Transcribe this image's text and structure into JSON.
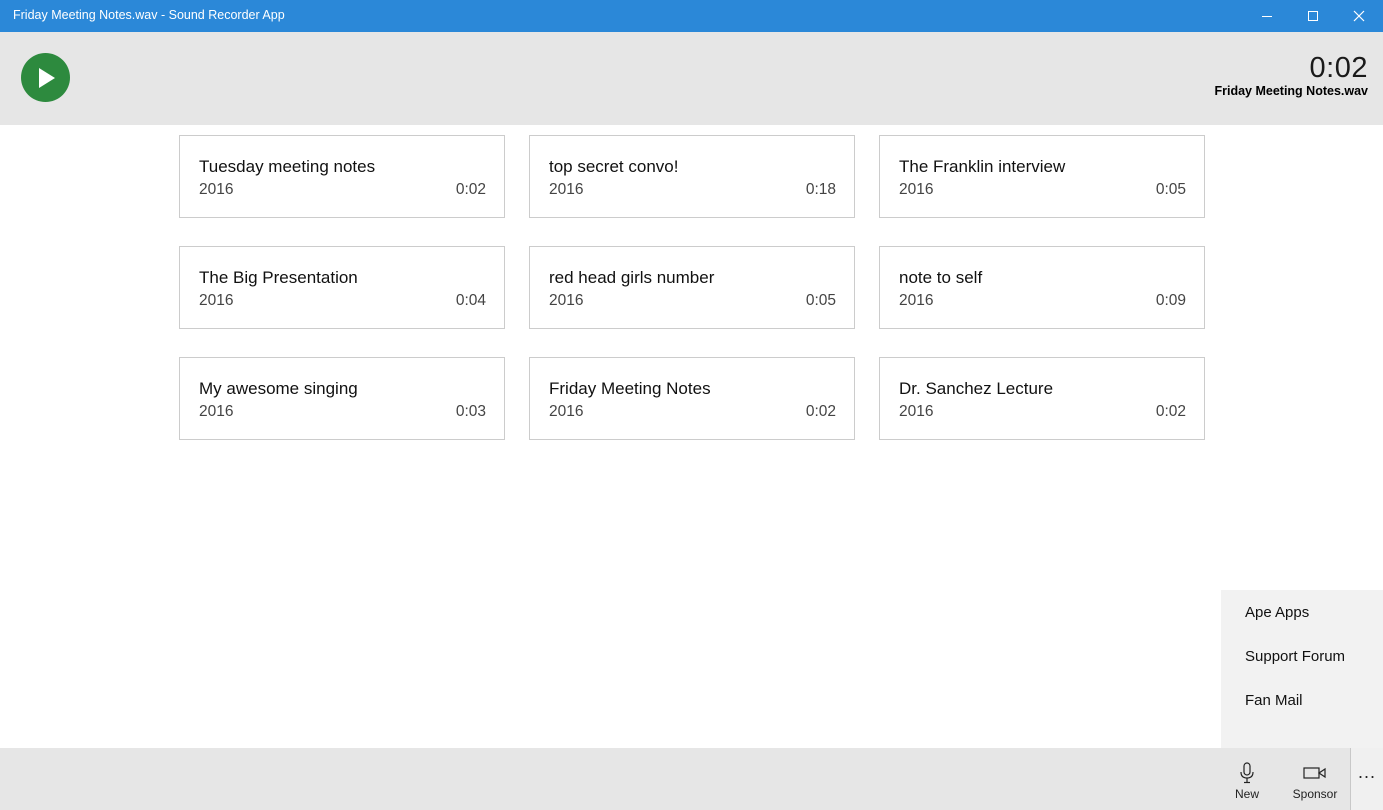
{
  "window": {
    "title": "Friday Meeting Notes.wav - Sound Recorder App",
    "titlebar_color": "#2b88d8"
  },
  "player": {
    "play_icon": "play-icon",
    "play_color": "#2d8a3e",
    "current_time": "0:02",
    "current_file": "Friday Meeting Notes.wav"
  },
  "recordings": [
    {
      "title": "Tuesday meeting notes",
      "year": "2016",
      "duration": "0:02"
    },
    {
      "title": "top secret convo!",
      "year": "2016",
      "duration": "0:18"
    },
    {
      "title": "The Franklin interview",
      "year": "2016",
      "duration": "0:05"
    },
    {
      "title": "The Big Presentation",
      "year": "2016",
      "duration": "0:04"
    },
    {
      "title": "red head girls number",
      "year": "2016",
      "duration": "0:05"
    },
    {
      "title": "note to self",
      "year": "2016",
      "duration": "0:09"
    },
    {
      "title": "My awesome singing",
      "year": "2016",
      "duration": "0:03"
    },
    {
      "title": "Friday Meeting Notes",
      "year": "2016",
      "duration": "0:02"
    },
    {
      "title": "Dr. Sanchez Lecture",
      "year": "2016",
      "duration": "0:02"
    }
  ],
  "menu": {
    "items": [
      "Ape Apps",
      "Support Forum",
      "Fan Mail"
    ]
  },
  "appbar": {
    "new_label": "New",
    "sponsor_label": "Sponsor",
    "more_label": "..."
  }
}
